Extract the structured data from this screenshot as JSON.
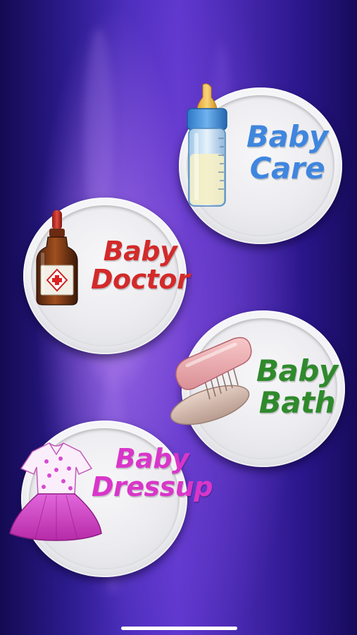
{
  "screen": {
    "background": "purple-radial-gradient",
    "colors": {
      "care": "#3f86de",
      "doctor": "#d32a2a",
      "bath": "#2f8a2c",
      "dressup": "#d936c9"
    }
  },
  "menu": [
    {
      "id": "care",
      "line1": "Baby",
      "line2": "Care",
      "icon": "baby-bottle-icon"
    },
    {
      "id": "doctor",
      "line1": "Baby",
      "line2": "Doctor",
      "icon": "medicine-bottle-icon"
    },
    {
      "id": "bath",
      "line1": "Baby",
      "line2": "Bath",
      "icon": "bath-brush-icon"
    },
    {
      "id": "dressup",
      "line1": "Baby",
      "line2": "Dressup",
      "icon": "baby-dress-icon"
    }
  ]
}
